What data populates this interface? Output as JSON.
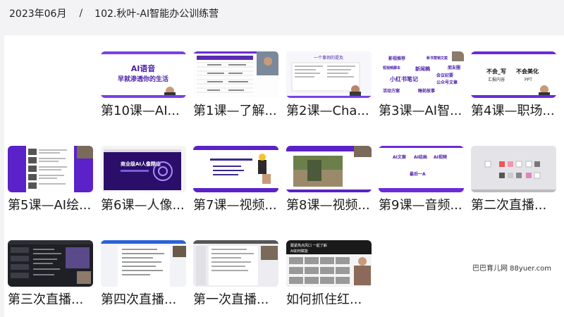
{
  "breadcrumb": {
    "date": "2023年06月",
    "separator": "/",
    "folder": "102.秋叶-AI智能办公训练营"
  },
  "items": [
    {
      "title": "第10课—AI..."
    },
    {
      "title": "第1课—了解..."
    },
    {
      "title": "第2课—Cha..."
    },
    {
      "title": "第3课—AI智..."
    },
    {
      "title": "第4课—职场..."
    },
    {
      "title": "第5课—AI绘..."
    },
    {
      "title": "第6课—人像..."
    },
    {
      "title": "第7课—视频..."
    },
    {
      "title": "第8课—视频..."
    },
    {
      "title": "第9课—音频..."
    },
    {
      "title": "第二次直播..."
    },
    {
      "title": "第三次直播..."
    },
    {
      "title": "第四次直播..."
    },
    {
      "title": "第一次直播..."
    },
    {
      "title": "如何抓住红..."
    }
  ],
  "thumb_text": {
    "t10_line1": "AI语音",
    "t10_line2": "早就渗透你的生活",
    "t2_heading": "一个事例的提及",
    "t3_words": [
      "影视推荐",
      "新书营销文案",
      "朋友圈",
      "短视频脚本",
      "新闻稿",
      "会议纪要",
      "小红书笔记",
      "公众号文章",
      "活动方案",
      "睡前故事"
    ],
    "t4_left1": "不会_写",
    "t4_left2": "汇报内容",
    "t4_right1": "不会美化",
    "t4_right2": "PPT",
    "t6_text": "商业级AI人像精修",
    "t9_words": [
      "AI文案",
      "AI绘画",
      "AI视频",
      "最后一A"
    ],
    "t15_line1": "跟紧热点风口 一起了解",
    "t15_line2": "AI如何赋能"
  },
  "watermark": "巴巴育儿网 88yuer.com",
  "colors": {
    "purple": "#6b2bd9",
    "deep_purple": "#4b1fa8",
    "background": "#f3f3f5"
  }
}
